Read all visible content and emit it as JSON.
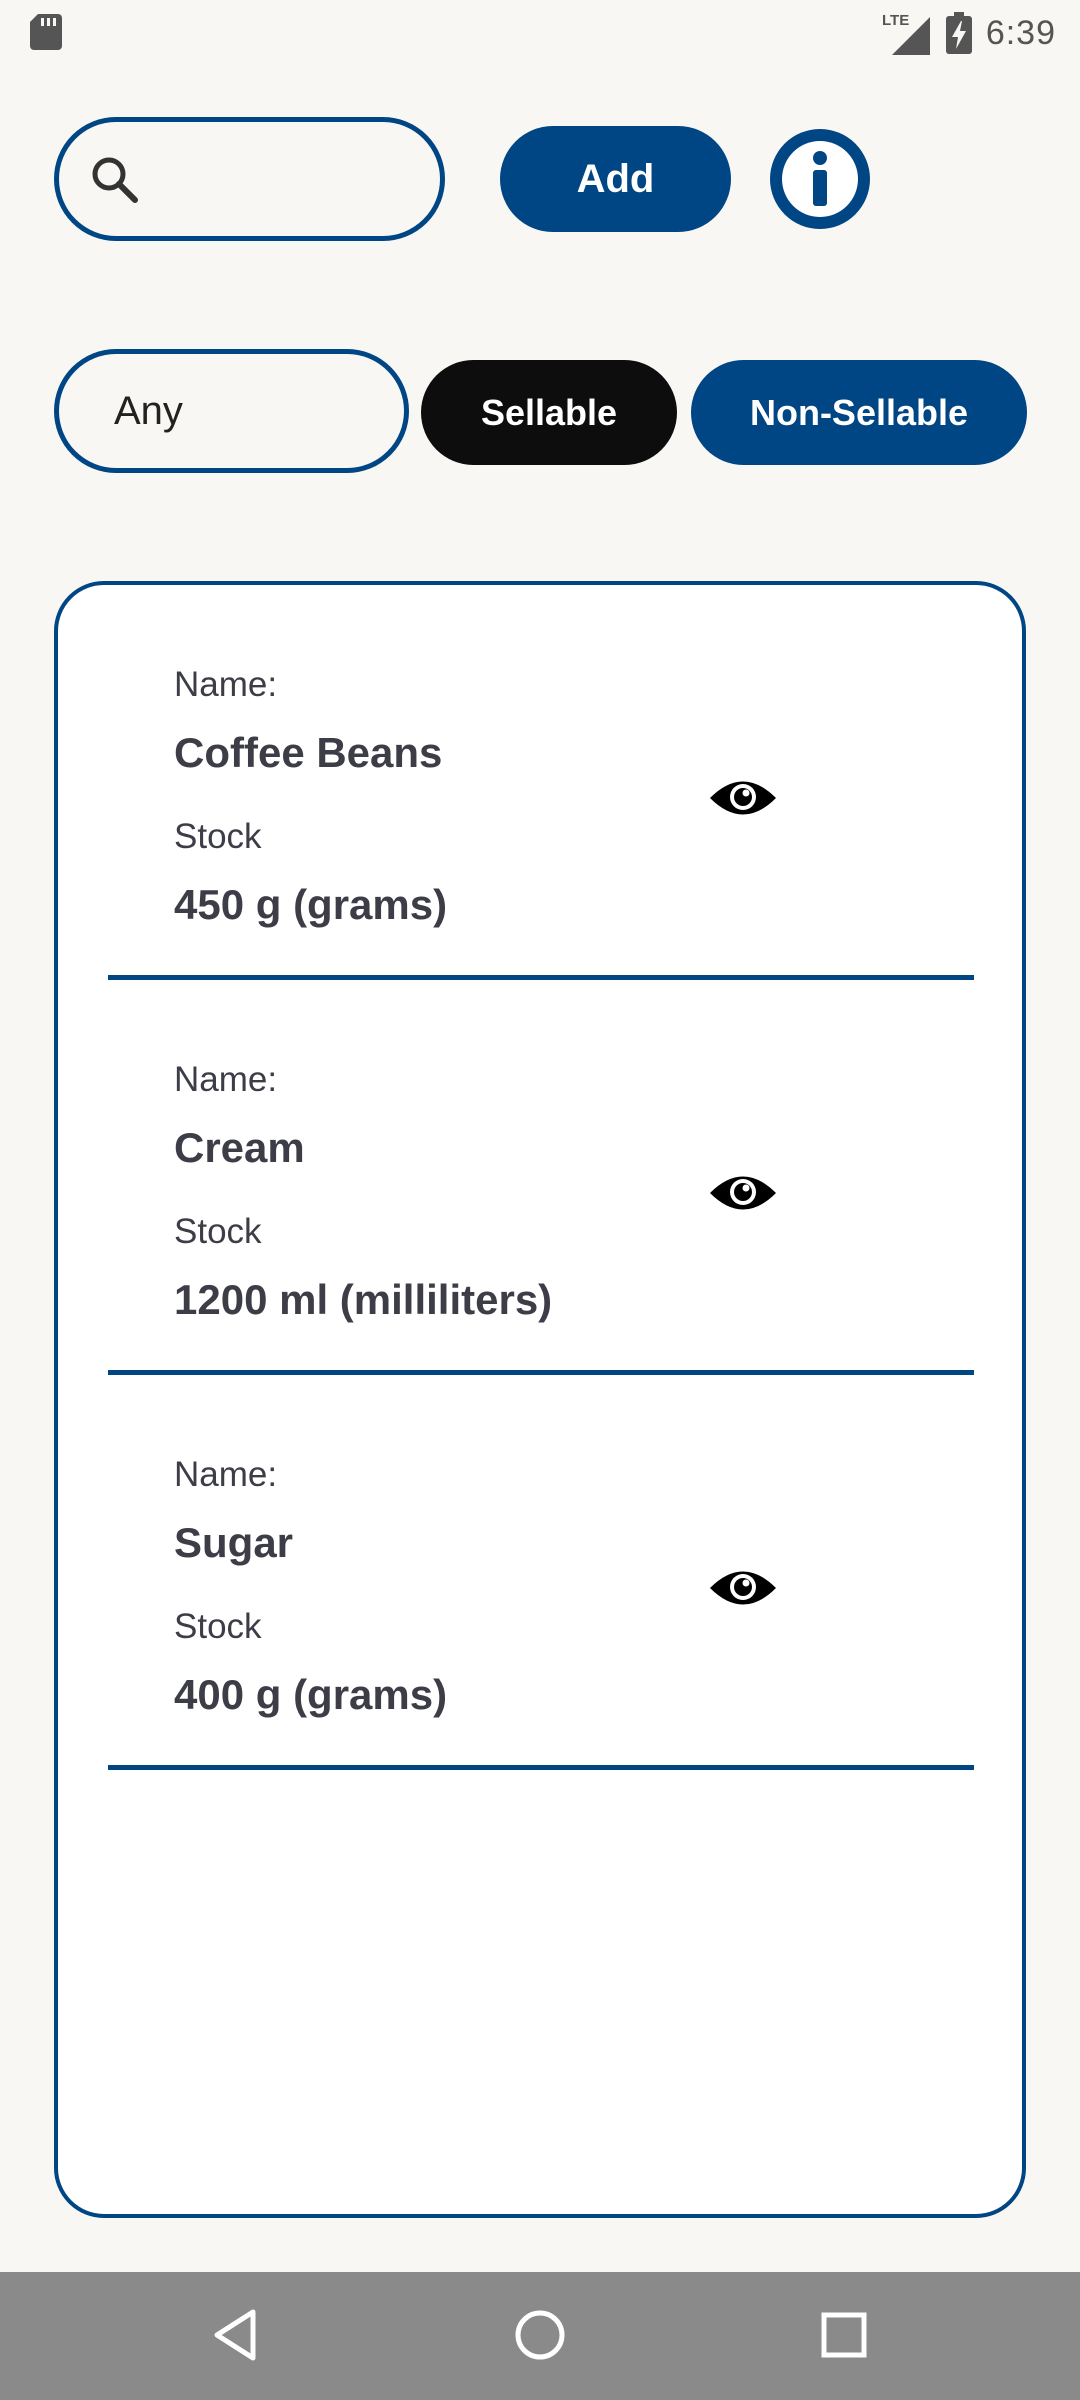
{
  "status_bar": {
    "network_label": "LTE",
    "time": "6:39",
    "icons": [
      "sd-card-icon",
      "signal-icon",
      "battery-charging-icon"
    ]
  },
  "toolbar": {
    "search_placeholder": "",
    "search_value": "",
    "add_label": "Add",
    "info_icon": "info-icon"
  },
  "filters": {
    "any_label": "Any",
    "sellable_label": "Sellable",
    "non_sellable_label": "Non-Sellable"
  },
  "items": [
    {
      "name_label": "Name:",
      "name": "Coffee Beans",
      "stock_label": "Stock",
      "stock": "450 g (grams)"
    },
    {
      "name_label": "Name:",
      "name": "Cream",
      "stock_label": "Stock",
      "stock": "1200 ml (milliliters)"
    },
    {
      "name_label": "Name:",
      "name": "Sugar",
      "stock_label": "Stock",
      "stock": "400 g (grams)"
    }
  ],
  "colors": {
    "primary": "#004584",
    "dark_button": "#0d0d0d",
    "background": "#f8f7f4",
    "card": "#ffffff",
    "text": "#3d3d47",
    "nav_bar": "#8a8a8a"
  }
}
